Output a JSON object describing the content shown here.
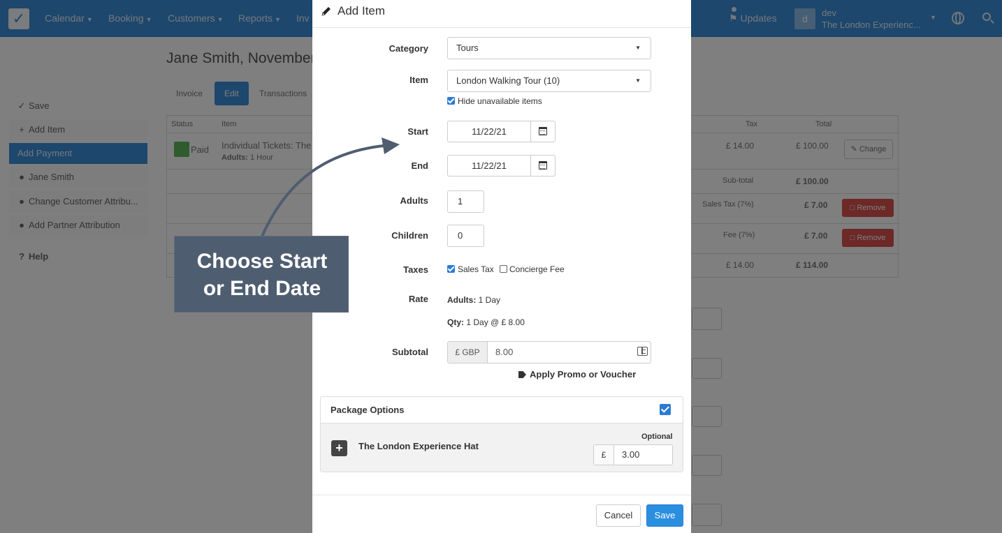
{
  "nav": {
    "items": [
      {
        "label": "Calendar"
      },
      {
        "label": "Booking"
      },
      {
        "label": "Customers"
      },
      {
        "label": "Reports"
      },
      {
        "label": "Inv"
      }
    ],
    "updates_label": "Updates",
    "avatar_initial": "d",
    "user_name": "dev",
    "user_org": "The London Experienc...",
    "colors": {
      "bar": "#3a8fd9"
    }
  },
  "background": {
    "page_title": "Jane Smith, November",
    "tabs": [
      "Invoice",
      "Edit",
      "Transactions"
    ],
    "sidebar": [
      {
        "icon": "check-icon",
        "label": "Save"
      },
      {
        "icon": "plus-icon",
        "label": "Add Item"
      },
      {
        "icon": "",
        "label": "Add Payment"
      },
      {
        "icon": "user-icon",
        "label": "Jane Smith"
      },
      {
        "icon": "user-icon",
        "label": "Change Customer Attribu..."
      },
      {
        "icon": "users-icon",
        "label": "Add Partner Attribution"
      },
      {
        "icon": "help-icon",
        "label": "Help"
      }
    ],
    "table": {
      "headers": {
        "status": "Status",
        "item": "Item",
        "tax": "Tax",
        "total": "Total"
      },
      "row_status": "Paid",
      "row_item": "Individual Tickets: The",
      "row_item_sub_label": "Adults:",
      "row_item_sub_value": "1 Hour",
      "row_tax": "£ 14.00",
      "row_total": "£ 100.00",
      "change_label": "Change",
      "subtotal_label": "Sub-total",
      "subtotal_value": "£ 100.00",
      "sales_tax_label": "Sales Tax (7%)",
      "sales_tax_value": "£ 7.00",
      "fee_label": "Fee (7%)",
      "fee_value": "£ 7.00",
      "remove_label": "Remove",
      "total_tax": "£ 14.00",
      "total_value": "£ 114.00"
    }
  },
  "modal": {
    "title": "Add Item",
    "category_label": "Category",
    "category_value": "Tours",
    "item_label": "Item",
    "item_value": "London Walking Tour (10)",
    "hide_unavailable_label": "Hide unavailable items",
    "hide_unavailable_checked": true,
    "start_label": "Start",
    "start_value": "11/22/21",
    "end_label": "End",
    "end_value": "11/22/21",
    "adults_label": "Adults",
    "adults_value": "1",
    "children_label": "Children",
    "children_value": "0",
    "taxes_label": "Taxes",
    "tax_sales_label": "Sales Tax",
    "tax_sales_checked": true,
    "tax_concierge_label": "Concierge Fee",
    "tax_concierge_checked": false,
    "rate_label": "Rate",
    "rate_adults_key": "Adults:",
    "rate_adults_value": "1 Day",
    "rate_qty_key": "Qty:",
    "rate_qty_value": "1 Day @ £ 8.00",
    "subtotal_label": "Subtotal",
    "subtotal_currency": "£ GBP",
    "subtotal_value": "8.00",
    "promo_label": "Apply Promo or Voucher",
    "package": {
      "title": "Package Options",
      "checked": true,
      "option_name": "The London Experience Hat",
      "option_tag": "Optional",
      "option_currency": "£",
      "option_price": "3.00"
    },
    "cancel_label": "Cancel",
    "save_label": "Save",
    "colors": {
      "primary": "#2b8fe0"
    }
  },
  "callout": {
    "line1": "Choose Start",
    "line2": "or End Date",
    "color": "#4f5d70"
  }
}
